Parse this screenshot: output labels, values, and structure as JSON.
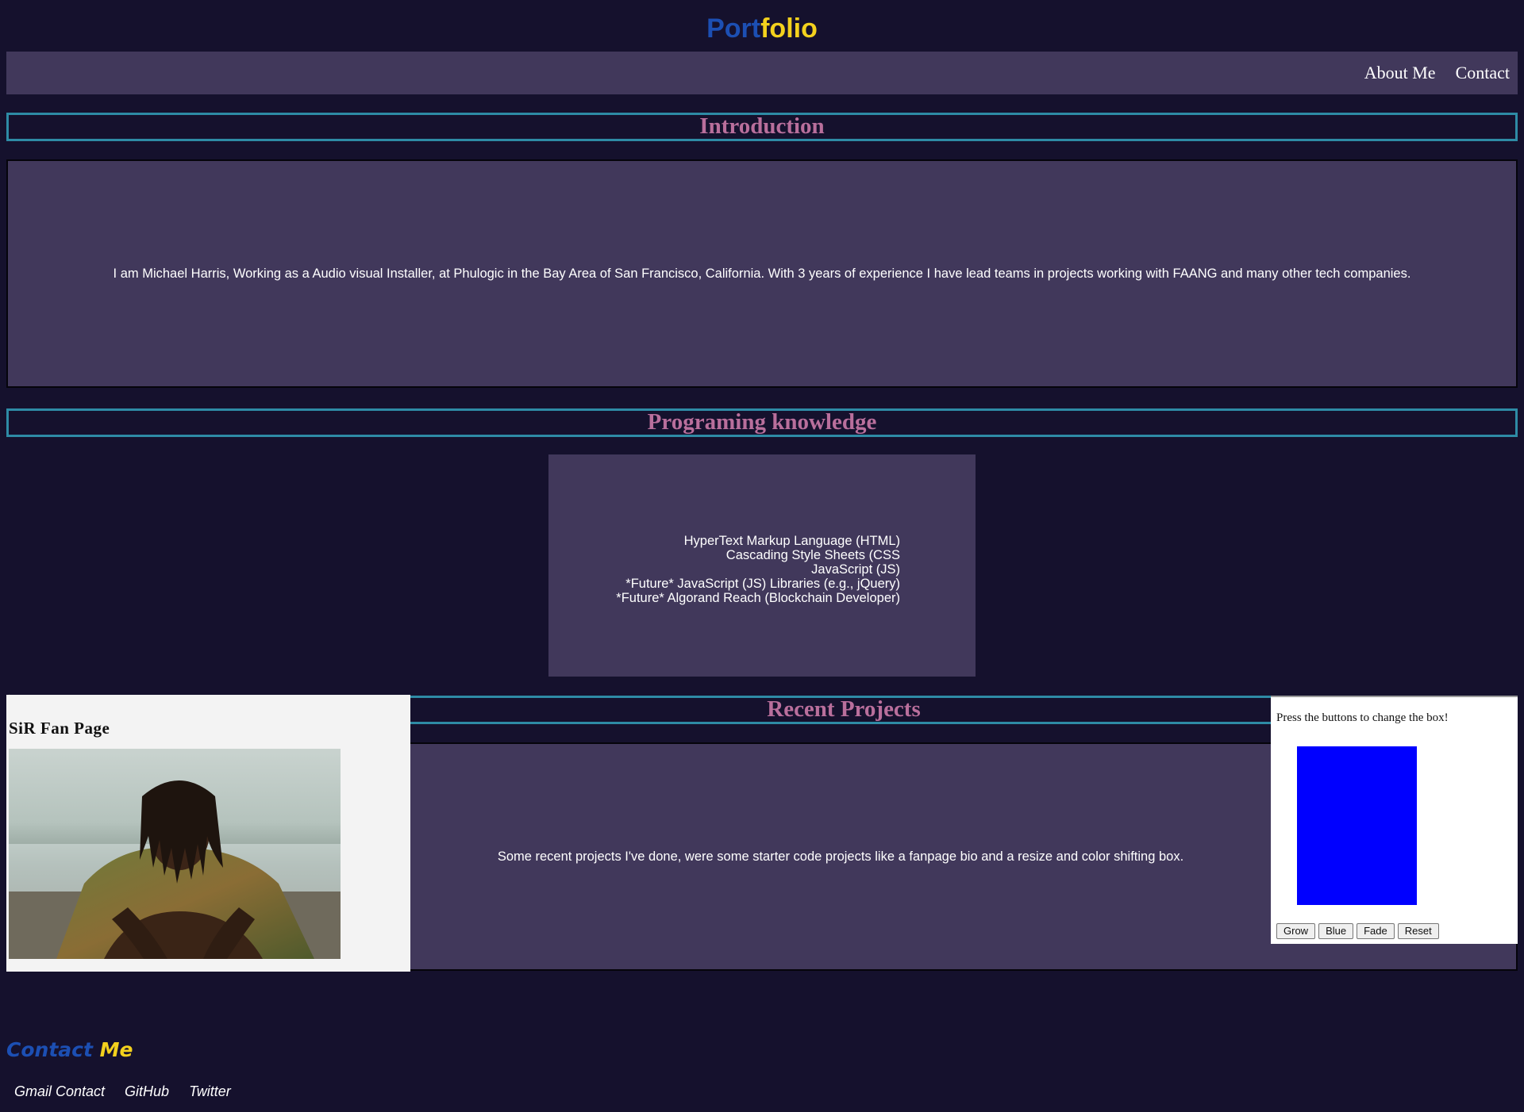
{
  "header": {
    "title_part1": "Port",
    "title_part2": "folio"
  },
  "nav": {
    "items": [
      {
        "label": "About Me"
      },
      {
        "label": "Contact"
      }
    ]
  },
  "introduction": {
    "heading": "Introduction",
    "text": "I am Michael Harris, Working as a Audio visual Installer, at Phulogic in the Bay Area of San Francisco, California. With 3 years of experience I have lead teams in projects working with FAANG and many other tech companies."
  },
  "programming": {
    "heading": "Programing knowledge",
    "items": [
      "HyperText Markup Language (HTML)",
      "Cascading Style Sheets (CSS",
      "JavaScript (JS)",
      "*Future* JavaScript (JS) Libraries (e.g., jQuery)",
      "*Future* Algorand Reach (Blockchain Developer)"
    ]
  },
  "projects": {
    "heading": "Recent Projects",
    "text": "Some recent projects I've done, were some starter code projects like a fanpage bio and a resize and color shifting box.",
    "fanpage": {
      "marker": "·",
      "title": "SiR Fan Page"
    },
    "box_widget": {
      "instruction": "Press the buttons to change the box!",
      "box_color": "#0000ff",
      "buttons": [
        "Grow",
        "Blue",
        "Fade",
        "Reset"
      ]
    }
  },
  "contact": {
    "heading_part1": "Contact",
    "heading_part2": "Me",
    "links": [
      "Gmail Contact",
      "GitHub",
      "Twitter"
    ]
  },
  "colors": {
    "background": "#15112d",
    "panel": "#41385b",
    "heading_border": "#2e8ba5",
    "heading_text": "#b96f9c",
    "title_blue": "#1c4fb3",
    "title_yellow": "#f3d11d"
  }
}
